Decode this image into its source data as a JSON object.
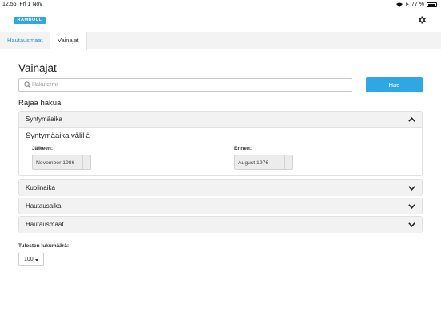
{
  "status_bar": {
    "time": "12.56",
    "date": "Fri 1 Nov",
    "battery": "77 %"
  },
  "header": {
    "logo_text": "RAMBOLL"
  },
  "tabs": [
    {
      "label": "Hautausmaat",
      "active": false
    },
    {
      "label": "Vainajat",
      "active": true
    }
  ],
  "page": {
    "title": "Vainajat",
    "search_placeholder": "Hakutermi",
    "search_button": "Hae",
    "filter_heading": "Rajaa hakua"
  },
  "filters": {
    "birth": {
      "label": "Syntymäaika",
      "expanded": true,
      "range_heading": "Syntymäaika välillä",
      "after_label": "Jälkeen:",
      "after_value": "November 1986",
      "before_label": "Ennen:",
      "before_value": "August 1976"
    },
    "death": {
      "label": "Kuolinaika",
      "expanded": false
    },
    "burial": {
      "label": "Hautausaika",
      "expanded": false
    },
    "cemetery": {
      "label": "Hautausmaat",
      "expanded": false
    }
  },
  "results": {
    "count_label": "Tulosten lukumäärä:",
    "count_value": "100"
  },
  "colors": {
    "accent": "#2fa7e3",
    "tab_active_text": "#2a8fd4"
  }
}
